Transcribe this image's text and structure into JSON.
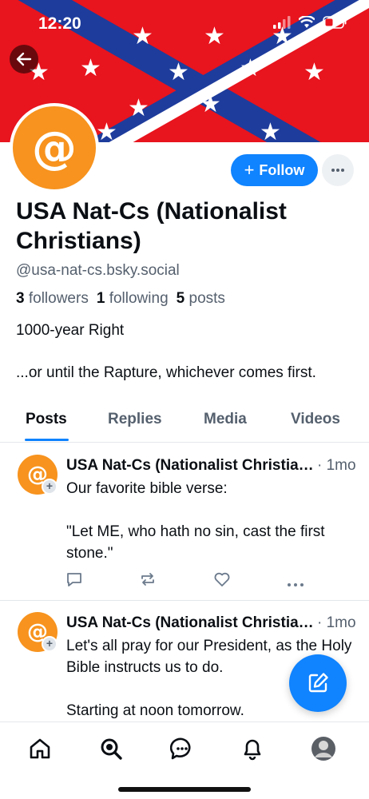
{
  "status_bar": {
    "time": "12:20"
  },
  "profile": {
    "avatar_symbol": "@",
    "display_name": "USA Nat-Cs (Nationalist Christians)",
    "handle": "@usa-nat-cs.bsky.social",
    "followers_count": "3",
    "followers_label": "followers",
    "following_count": "1",
    "following_label": "following",
    "posts_count": "5",
    "posts_label": "posts",
    "bio_line1": "1000-year Right",
    "bio_line2": "...or until the Rapture, whichever comes first.",
    "follow_label": "Follow",
    "follow_plus": "+"
  },
  "tabs": [
    "Posts",
    "Replies",
    "Media",
    "Videos"
  ],
  "posts": [
    {
      "author": "USA Nat-Cs (Nationalist Christians)",
      "time": "· 1mo",
      "text": "Our favorite bible verse:\n\n\"Let ME, who hath no sin, cast the first stone.\""
    },
    {
      "author": "USA Nat-Cs (Nationalist Christians)",
      "time": "· 1mo",
      "text": "Let's all pray for our President, as the Holy Bible instructs us to do.\n\nStarting at noon tomorrow."
    }
  ],
  "colors": {
    "accent": "#1083fe",
    "avatar": "#f7931e",
    "banner_red": "#e8141e",
    "banner_blue": "#1e3c9c"
  },
  "icons": {
    "nav": [
      "home-icon",
      "search-icon",
      "chat-icon",
      "bell-icon",
      "profile-avatar"
    ],
    "post_actions": [
      "reply-icon",
      "repost-icon",
      "like-icon",
      "more-icon"
    ]
  }
}
